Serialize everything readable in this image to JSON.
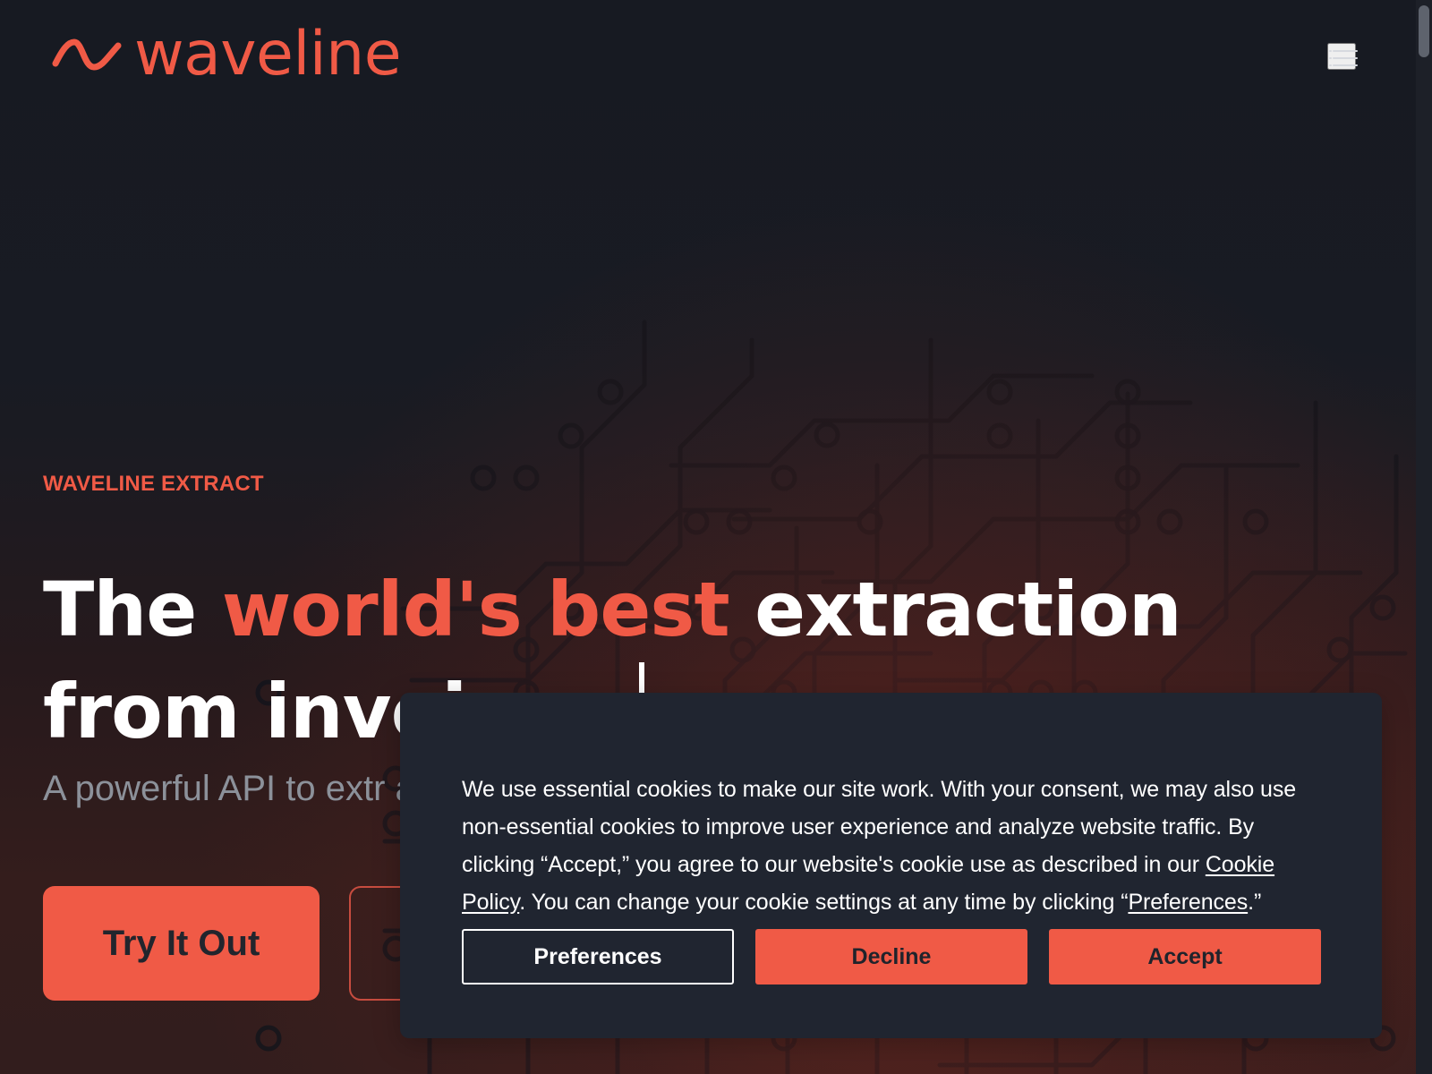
{
  "brand": {
    "name": "waveline",
    "accent_color": "#f05a46",
    "background_color": "#171a22"
  },
  "navigation": {
    "menu_icon": "menu-icon"
  },
  "hero": {
    "eyebrow": "WAVELINE EXTRACT",
    "headline_before": "The ",
    "headline_accent": "world's best",
    "headline_after": " extraction from invoices.",
    "subtitle": "A powerful API to extr and PDFs.",
    "primary_cta": "Try It Out",
    "secondary_cta": ""
  },
  "cookie_banner": {
    "text_before_policy": "We use essential cookies to make our site work. With your consent, we may also use non-essential cookies to improve user experience and analyze website traffic. By clicking “Accept,” you agree to our website's cookie use as described in our ",
    "policy_link": "Cookie Policy",
    "text_after_policy": ". You can change your cookie settings at any time by clicking “",
    "preferences_link": "Preferences",
    "text_end": ".”",
    "buttons": {
      "preferences": "Preferences",
      "decline": "Decline",
      "accept": "Accept"
    },
    "background_color": "#202530"
  }
}
